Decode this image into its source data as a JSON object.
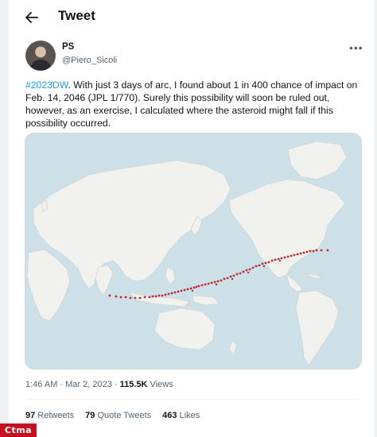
{
  "header": {
    "title": "Tweet"
  },
  "author": {
    "name": "PS",
    "handle": "@Piero_Sicoli"
  },
  "tweet": {
    "hashtag": "#2023DW",
    "body": ". With just 3 days of arc, I found about 1 in 400 chance of impact on Feb. 14, 2046 (JPL 1/770). Surely this possibility will soon be ruled out, however, as an exercise, I calculated where the asteroid might fall if this possibility occurred."
  },
  "meta": {
    "time": "1:46 AM · Mar 2, 2023 · ",
    "views_count": "115.5K",
    "views_label": " Views"
  },
  "stats": {
    "retweets_count": "97",
    "retweets_label": " Retweets",
    "quotes_count": "79",
    "quotes_label": " Quote Tweets",
    "likes_count": "463",
    "likes_label": " Likes"
  },
  "icons": {
    "back": "arrow-left-icon",
    "more": "more-dots-icon"
  },
  "colors": {
    "accent": "#1d9bf0",
    "impact_points": "#c0262d",
    "ocean": "#cde0e7",
    "land": "#f1f1ee"
  },
  "watermark": "Ctma"
}
